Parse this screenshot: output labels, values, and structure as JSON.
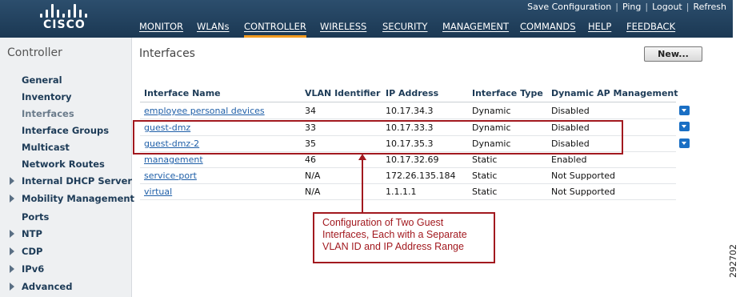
{
  "header": {
    "brand": "CISCO",
    "utility_links": [
      "Save Configuration",
      "Ping",
      "Logout",
      "Refresh"
    ],
    "nav": [
      {
        "label": "MONITOR",
        "active": false
      },
      {
        "label": "WLANs",
        "active": false
      },
      {
        "label": "CONTROLLER",
        "active": true
      },
      {
        "label": "WIRELESS",
        "active": false
      },
      {
        "label": "SECURITY",
        "active": false
      },
      {
        "label": "MANAGEMENT",
        "active": false
      },
      {
        "label": "COMMANDS",
        "active": false
      },
      {
        "label": "HELP",
        "active": false
      },
      {
        "label": "FEEDBACK",
        "active": false
      }
    ]
  },
  "sidebar": {
    "title": "Controller",
    "items": [
      {
        "label": "General",
        "expandable": false,
        "current": false
      },
      {
        "label": "Inventory",
        "expandable": false,
        "current": false
      },
      {
        "label": "Interfaces",
        "expandable": false,
        "current": true
      },
      {
        "label": "Interface Groups",
        "expandable": false,
        "current": false
      },
      {
        "label": "Multicast",
        "expandable": false,
        "current": false
      },
      {
        "label": "Network Routes",
        "expandable": false,
        "current": false
      },
      {
        "label": "Internal DHCP Server",
        "expandable": true,
        "current": false
      },
      {
        "label": "Mobility Management",
        "expandable": true,
        "current": false
      },
      {
        "label": "Ports",
        "expandable": false,
        "current": false
      },
      {
        "label": "NTP",
        "expandable": true,
        "current": false
      },
      {
        "label": "CDP",
        "expandable": true,
        "current": false
      },
      {
        "label": "IPv6",
        "expandable": true,
        "current": false
      },
      {
        "label": "Advanced",
        "expandable": true,
        "current": false
      }
    ]
  },
  "main": {
    "title": "Interfaces",
    "new_button": "New...",
    "columns": [
      "Interface Name",
      "VLAN Identifier",
      "IP Address",
      "Interface Type",
      "Dynamic AP Management"
    ],
    "rows": [
      {
        "name": "employee personal devices",
        "vlan": "34",
        "ip": "10.17.34.3",
        "type": "Dynamic",
        "dyn_ap": "Disabled",
        "has_dropdown": true
      },
      {
        "name": "guest-dmz",
        "vlan": "33",
        "ip": "10.17.33.3",
        "type": "Dynamic",
        "dyn_ap": "Disabled",
        "has_dropdown": true
      },
      {
        "name": "guest-dmz-2",
        "vlan": "35",
        "ip": "10.17.35.3",
        "type": "Dynamic",
        "dyn_ap": "Disabled",
        "has_dropdown": true
      },
      {
        "name": "management",
        "vlan": "46",
        "ip": "10.17.32.69",
        "type": "Static",
        "dyn_ap": "Enabled",
        "has_dropdown": false
      },
      {
        "name": "service-port",
        "vlan": "N/A",
        "ip": "172.26.135.184",
        "type": "Static",
        "dyn_ap": "Not Supported",
        "has_dropdown": false
      },
      {
        "name": "virtual",
        "vlan": "N/A",
        "ip": "1.1.1.1",
        "type": "Static",
        "dyn_ap": "Not Supported",
        "has_dropdown": false
      }
    ]
  },
  "annotation": {
    "callout_lines": [
      "Configuration of Two Guest",
      "Interfaces, Each with a Separate",
      "VLAN ID and IP Address Range"
    ],
    "color": "#a2191f"
  },
  "figure_id": "292702",
  "colors": {
    "header_bg": "#1b3853",
    "active_tab_underline": "#f29a1e",
    "link": "#1f5fa8",
    "sidebar_bg": "#eef0f2"
  }
}
